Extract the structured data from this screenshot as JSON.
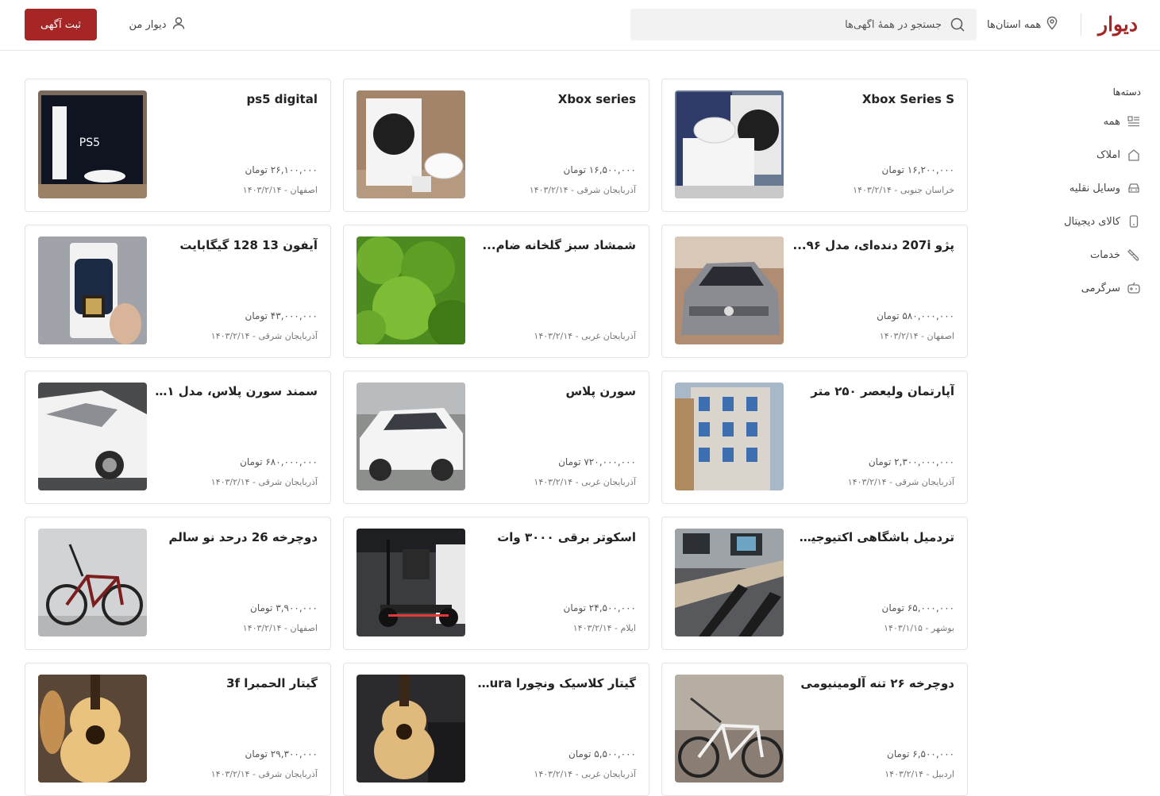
{
  "header": {
    "logo": "دیوار",
    "city_label": "همه استان‌ها",
    "search_placeholder": "جستجو در همهٔ آگهی‌ها",
    "my_divar": "دیوار من",
    "post_button": "ثبت آگهی"
  },
  "sidebar": {
    "title": "دسته‌ها",
    "items": [
      {
        "label": "همه",
        "icon": "list-icon"
      },
      {
        "label": "املاک",
        "icon": "home-icon"
      },
      {
        "label": "وسایل نقلیه",
        "icon": "car-icon"
      },
      {
        "label": "کالای دیجیتال",
        "icon": "phone-icon"
      },
      {
        "label": "خدمات",
        "icon": "brush-icon"
      },
      {
        "label": "سرگرمی",
        "icon": "gamepad-icon"
      }
    ]
  },
  "listings": [
    {
      "title": "Xbox Series S",
      "price": "۱۶,۲۰۰,۰۰۰ تومان",
      "meta": "خراسان جنوبی - ۱۴۰۳/۲/۱۴",
      "image": "xbox-console-image"
    },
    {
      "title": "Xbox series",
      "price": "۱۶,۵۰۰,۰۰۰ تومان",
      "meta": "آذربایجان شرقی - ۱۴۰۳/۲/۱۴",
      "image": "xbox-console-image"
    },
    {
      "title": "ps5 digital",
      "price": "۲۶,۱۰۰,۰۰۰ تومان",
      "meta": "اصفهان - ۱۴۰۳/۲/۱۴",
      "image": "ps5-box-image"
    },
    {
      "title": "پژو 207i دنده‌ای، مدل ۹۶...",
      "price": "۵۸۰,۰۰۰,۰۰۰ تومان",
      "meta": "اصفهان - ۱۴۰۳/۲/۱۴",
      "image": "car-image"
    },
    {
      "title": "شمشاد سبز گلخانه ضام...",
      "price": "",
      "meta": "آذربایجان غربی - ۱۴۰۳/۲/۱۴",
      "image": "plant-image"
    },
    {
      "title": "آیفون 13 128 گیگابایت",
      "price": "۴۳,۰۰۰,۰۰۰ تومان",
      "meta": "آذربایجان شرقی - ۱۴۰۳/۲/۱۴",
      "image": "phone-box-image"
    },
    {
      "title": "آپارتمان ولیعصر ۲۵۰ متر",
      "price": "۲,۳۰۰,۰۰۰,۰۰۰ تومان",
      "meta": "آذربایجان شرقی - ۱۴۰۳/۲/۱۴",
      "image": "building-image"
    },
    {
      "title": "سورن پلاس",
      "price": "۷۲۰,۰۰۰,۰۰۰ تومان",
      "meta": "آذربایجان غربی - ۱۴۰۳/۲/۱۴",
      "image": "white-car-image"
    },
    {
      "title": "سمند سورن پلاس، مدل ۱...",
      "price": "۶۸۰,۰۰۰,۰۰۰ تومان",
      "meta": "آذربایجان شرقی - ۱۴۰۳/۲/۱۴",
      "image": "white-car-image"
    },
    {
      "title": "تردمیل باشگاهی اکتیوجیم...",
      "price": "۶۵,۰۰۰,۰۰۰ تومان",
      "meta": "بوشهر - ۱۴۰۳/۱/۱۵",
      "image": "treadmill-image"
    },
    {
      "title": "اسکوتر برقی ۳۰۰۰ وات",
      "price": "۲۴,۵۰۰,۰۰۰ تومان",
      "meta": "ایلام - ۱۴۰۳/۲/۱۴",
      "image": "scooter-image"
    },
    {
      "title": "دوچرخه 26 درحد نو سالم",
      "price": "۳,۹۰۰,۰۰۰ تومان",
      "meta": "اصفهان - ۱۴۰۳/۲/۱۴",
      "image": "bicycle-image"
    },
    {
      "title": "دوچرخه ۲۶ تنه آلومینیومی",
      "price": "۶,۵۰۰,۰۰۰ تومان",
      "meta": "اردبیل - ۱۴۰۳/۲/۱۴",
      "image": "bicycle-image"
    },
    {
      "title": "گیتار کلاسیک ونچورا tura...",
      "price": "۵,۵۰۰,۰۰۰ تومان",
      "meta": "آذربایجان غربی - ۱۴۰۳/۲/۱۴",
      "image": "guitar-image"
    },
    {
      "title": "گیتار الحمبرا 3f",
      "price": "۲۹,۳۰۰,۰۰۰ تومان",
      "meta": "آذربایجان شرقی - ۱۴۰۳/۲/۱۴",
      "image": "guitar-image"
    }
  ],
  "colors": {
    "brand": "#a62626",
    "border": "#e3e3e3",
    "search_bg": "#f2f2f2"
  }
}
